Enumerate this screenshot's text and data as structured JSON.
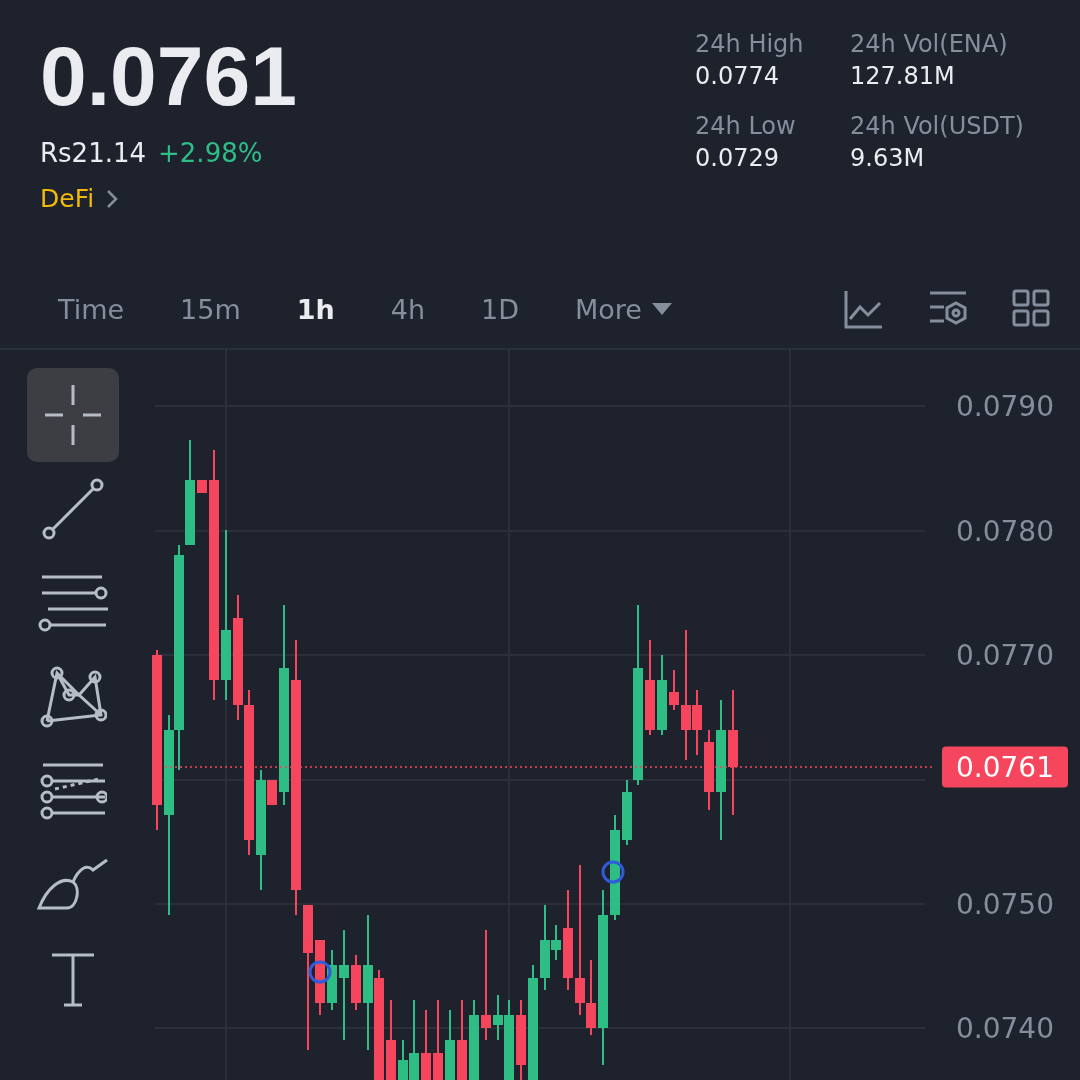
{
  "ticker": {
    "price": "0.0761",
    "fiat_price": "Rs21.14",
    "change": "+2.98%",
    "tag": "DeFi"
  },
  "stats": [
    {
      "label": "24h High",
      "value": "0.0774"
    },
    {
      "label": "24h Vol(ENA)",
      "value": "127.81M"
    },
    {
      "label": "24h Low",
      "value": "0.0729"
    },
    {
      "label": "24h Vol(USDT)",
      "value": "9.63M"
    }
  ],
  "intervals": [
    {
      "label": "Time",
      "selected": false
    },
    {
      "label": "15m",
      "selected": false
    },
    {
      "label": "1h",
      "selected": true
    },
    {
      "label": "4h",
      "selected": false
    },
    {
      "label": "1D",
      "selected": false
    },
    {
      "label": "More",
      "selected": false,
      "kind": "dropdown"
    }
  ],
  "tools": [
    {
      "kind": "crosshair",
      "selected": true
    },
    {
      "kind": "trendline",
      "selected": false
    },
    {
      "kind": "hlines",
      "selected": false
    },
    {
      "kind": "pattern",
      "selected": false
    },
    {
      "kind": "channel",
      "selected": false
    },
    {
      "kind": "brush",
      "selected": false
    },
    {
      "kind": "text",
      "selected": false
    }
  ],
  "price_axis": [
    "0.0790",
    "0.0780",
    "0.0770",
    "0.0750",
    "0.0740"
  ],
  "current_price_tag": "0.0761"
}
